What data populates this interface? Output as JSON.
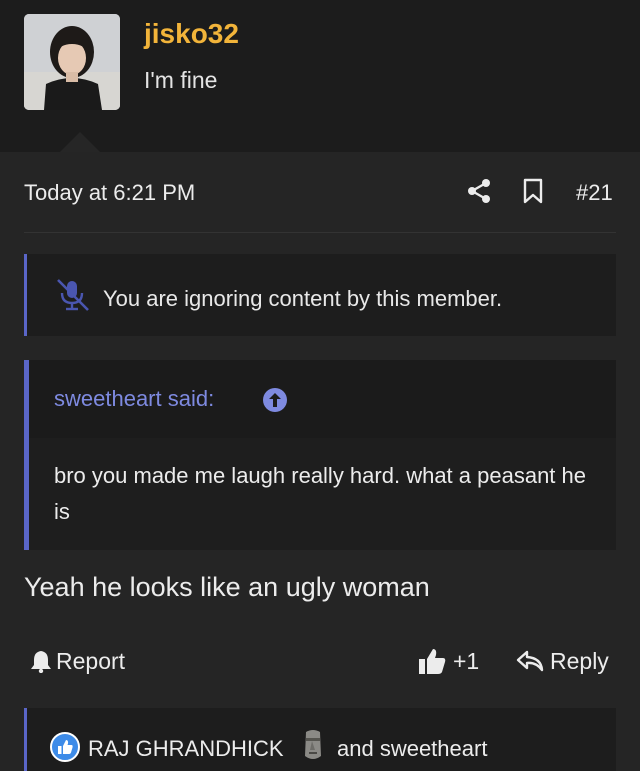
{
  "user": {
    "username": "jisko32",
    "title": "I'm fine"
  },
  "post": {
    "date": "Today at 6:21 PM",
    "number": "#21",
    "ignored_notice": "You are ignoring content by this member.",
    "quote": {
      "author": "sweetheart said:",
      "text": "bro you made me laugh really hard. what a peasant he is"
    },
    "message": "Yeah he looks like an ugly woman"
  },
  "actions": {
    "report": "Report",
    "like_count": "+1",
    "reply": "Reply"
  },
  "reactions": {
    "first_user": "RAJ GHRANDHICK",
    "rest": "and sweetheart"
  },
  "colors": {
    "username": "#f2b43a",
    "accent": "#5a66c8",
    "quote_author": "#7e8ae0",
    "background": "#202020"
  },
  "icons": [
    "share-icon",
    "bookmark-icon",
    "muted-mic-icon",
    "arrow-up-circle-icon",
    "bell-icon",
    "thumbs-up-icon",
    "reply-arrow-icon",
    "like-badge-icon",
    "moai-icon"
  ]
}
